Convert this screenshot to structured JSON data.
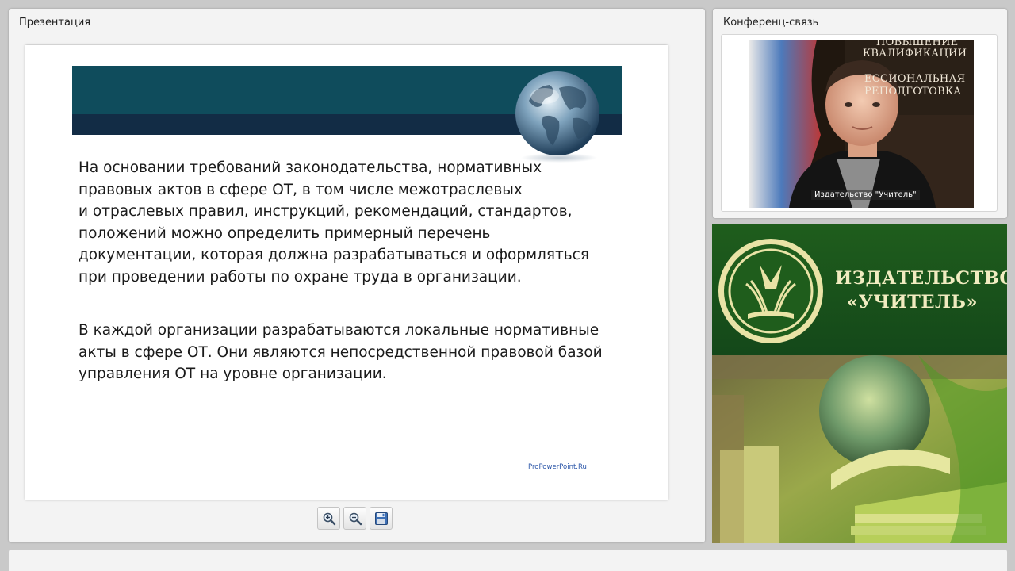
{
  "presentation_panel": {
    "title": "Презентация",
    "slide": {
      "paragraph_1": "На основании требований законодательства, нормативных\nправовых актов в сфере ОТ, в том числе межотраслевых\nи отраслевых правил, инструкций, рекомендаций, стандартов,\nположений можно определить примерный перечень\nдокументации, которая должна разрабатываться и оформляться\nпри проведении работы по охране труда в организации.",
      "paragraph_2": "В каждой организации разрабатываются локальные нормативные\nакты в сфере ОТ. Они являются непосредственной правовой базой\nуправления ОТ на уровне организации.",
      "credit": "ProPowerPoint.Ru",
      "band_top_color": "#0f4c5c",
      "band_bottom_color": "#122c45"
    },
    "toolbar": {
      "zoom_in_icon": "zoom-in-icon",
      "zoom_out_icon": "zoom-out-icon",
      "save_icon": "save-icon"
    }
  },
  "conference_panel": {
    "title": "Конференц-связь",
    "participant_label": "Издательство \"Учитель\"",
    "poster_lines": [
      "ПОВЫШЕНИЕ",
      "КВАЛИФИКАЦИИ",
      "ЕССИОНАЛЬНАЯ",
      "РЕПОДГОТОВКА"
    ]
  },
  "ad_panel": {
    "brand_line_1": "ИЗДАТЕЛЬСТВО",
    "brand_line_2": "«УЧИТЕЛЬ»",
    "brand_color": "#1f5d1c"
  }
}
